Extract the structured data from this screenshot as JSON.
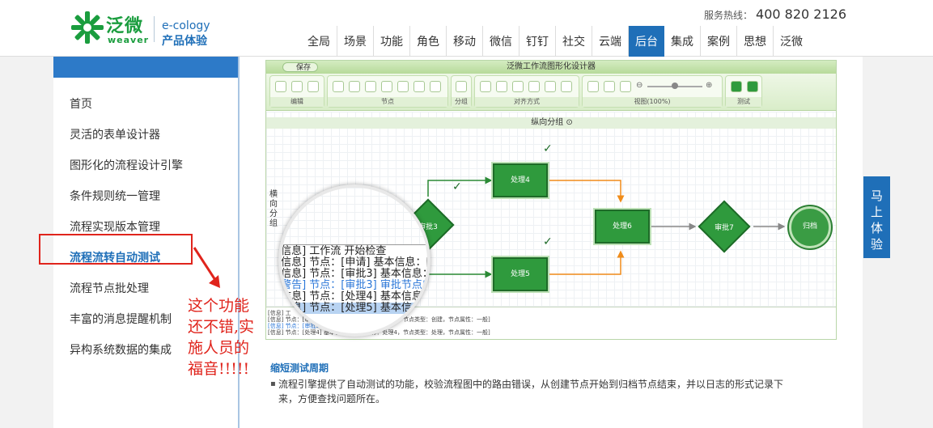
{
  "header": {
    "logo_cn": "泛微",
    "logo_en": "weaver",
    "product_en": "e-cology",
    "product_cn": "产品体验",
    "hotline_label": "服务热线：",
    "hotline_number": "400 820 2126"
  },
  "nav": {
    "items": [
      {
        "label": "全局"
      },
      {
        "label": "场景"
      },
      {
        "label": "功能"
      },
      {
        "label": "角色"
      },
      {
        "label": "移动"
      },
      {
        "label": "微信"
      },
      {
        "label": "钉钉"
      },
      {
        "label": "社交"
      },
      {
        "label": "云端"
      },
      {
        "label": "后台"
      },
      {
        "label": "集成"
      },
      {
        "label": "案例"
      },
      {
        "label": "思想"
      },
      {
        "label": "泛微"
      }
    ],
    "active": "后台"
  },
  "sidebar": {
    "items": [
      {
        "label": "首页"
      },
      {
        "label": "灵活的表单设计器"
      },
      {
        "label": "图形化的流程设计引擎"
      },
      {
        "label": "条件规则统一管理"
      },
      {
        "label": "流程实现版本管理"
      },
      {
        "label": "流程流转自动测试"
      },
      {
        "label": "流程节点批处理"
      },
      {
        "label": "丰富的消息提醒机制"
      },
      {
        "label": "异构系统数据的集成"
      }
    ],
    "active": "流程流转自动测试"
  },
  "designer": {
    "title": "泛微工作流图形化设计器",
    "save_label": "保存",
    "toolbar_groups": [
      "编辑",
      "节点",
      "分组",
      "对齐方式",
      "视图(100%)",
      "测试"
    ],
    "vertical_group": "纵向分组",
    "horizontal_group": "横向分组",
    "nodes": {
      "n4": "处理4",
      "n5": "处理5",
      "n6": "处理6",
      "d3": "审批3",
      "d7": "审批7",
      "end": "归档"
    },
    "log_lines": [
      "[信息] 工",
      "[信息] 节点：[审批3] 基本信息：[节点名称：审批3，节点类型：创建，节点属性：一般]",
      "[信息] 节点：[审批3] 审批节点应该设置出口",
      "[信息] 节点：[处理4] 基本信息：[节点名称：处理4，节点类型：处理，节点属性：一般]"
    ],
    "magnifier_lines": [
      "[信息] 工作流 开始检查",
      "[信息] 节点：[申请] 基本信息：[节点",
      "[信息] 节点：[审批3] 基本信息：[节",
      "[警告] 节点：[审批3] 审批节点应该",
      "[信息] 节点：[处理4] 基本信息：[节",
      "[信息] 节点：[处理5] 基本信息：[节"
    ]
  },
  "content": {
    "section_title": "缩短测试周期",
    "description": "流程引擎提供了自动测试的功能，校验流程图中的路由错误，从创建节点开始到归档节点结束，并以日志的形式记录下来，方便查找问题所在。"
  },
  "annotation": {
    "note_lines": [
      "这个功能",
      "还不错,实",
      "施人员的",
      "福音!!!!!"
    ]
  },
  "float_button": {
    "chars": [
      "马",
      "上",
      "体",
      "验"
    ]
  },
  "colors": {
    "brand_green": "#1a9d3e",
    "brand_blue": "#1f6fb8",
    "annotation_red": "#e0241c"
  }
}
